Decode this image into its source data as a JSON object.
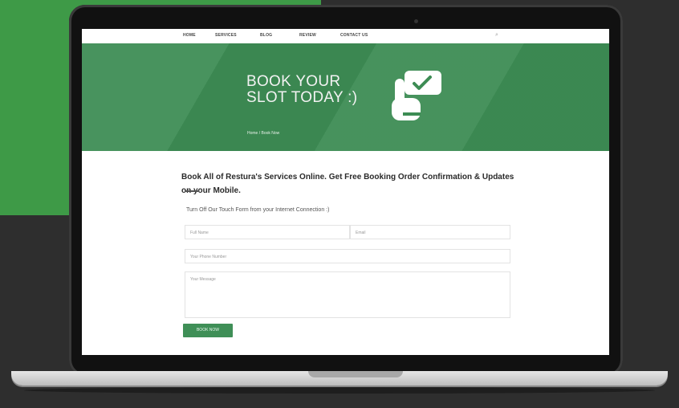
{
  "nav": {
    "items": [
      "HOME",
      "SERVICES",
      "BLOG",
      "REVIEW",
      "CONTACT US"
    ]
  },
  "hero": {
    "title": "BOOK YOUR\nSLOT TODAY :)",
    "breadcrumb": "Home / Book Now",
    "icon": "hand-tap-check-icon"
  },
  "booking": {
    "title": "Book All of Restura's Services Online. Get Free Booking Order Confirmation & Updates on your Mobile.",
    "subtitle": "Turn Off Our Touch Form from your Internet Connection :)",
    "fields": {
      "name_placeholder": "Full Name",
      "email_placeholder": "Email",
      "phone_placeholder": "Your Phone Number",
      "message_placeholder": "Your Message"
    },
    "submit_label": "BOOK NOW"
  },
  "colors": {
    "hero_green": "#3d8c54",
    "bg_green": "#3e9a47",
    "bg_dark": "#2e2e2e"
  }
}
